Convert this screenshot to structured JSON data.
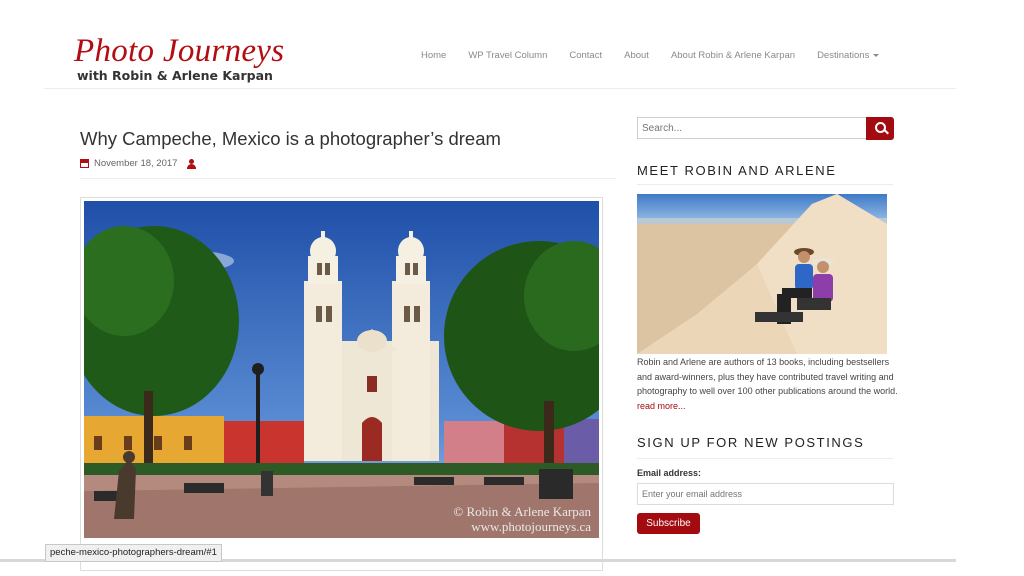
{
  "site": {
    "logo_title": "Photo Journeys",
    "logo_subtitle": "with Robin & Arlene Karpan"
  },
  "nav": {
    "items": [
      "Home",
      "WP Travel Column",
      "Contact",
      "About",
      "About Robin & Arlene Karpan",
      "Destinations"
    ]
  },
  "post": {
    "title": "Why Campeche, Mexico is a photographer’s dream",
    "date": "November 18, 2017",
    "watermark_line1": "© Robin & Arlene Karpan",
    "watermark_line2": "www.photojourneys.ca"
  },
  "sidebar": {
    "search_placeholder": "Search...",
    "meet_title": "MEET ROBIN AND ARLENE",
    "bio_text": "Robin and Arlene are authors of 13 books, including bestsellers and award-winners, plus they have contributed travel writing and photography to well over 100 other publications around the world.",
    "read_more": "read more...",
    "signup_title": "SIGN UP FOR NEW POSTINGS",
    "email_label": "Email address:",
    "email_placeholder": "Enter your email address",
    "subscribe_label": "Subscribe"
  },
  "status_bar": {
    "url": "peche-mexico-photographers-dream/#1"
  },
  "colors": {
    "brand_red": "#a30b10"
  }
}
